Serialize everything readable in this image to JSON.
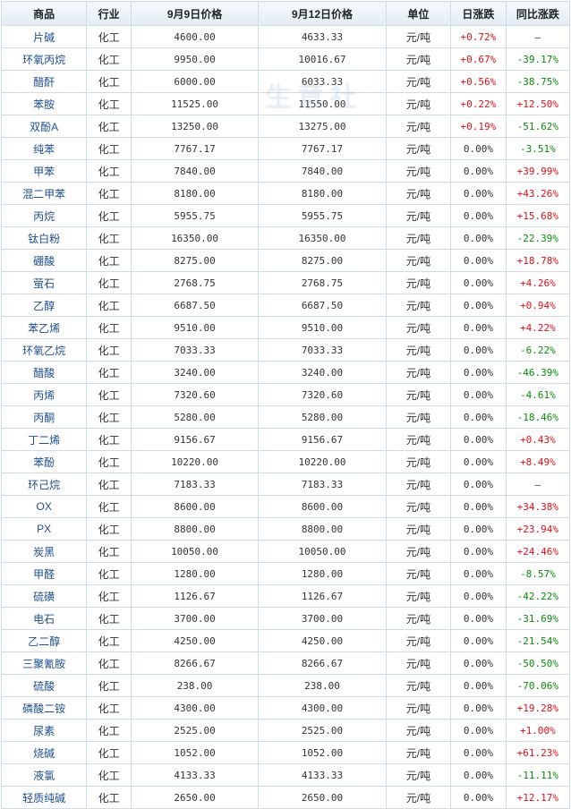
{
  "table": {
    "headers": [
      "商品",
      "行业",
      "9月9日价格",
      "9月12日价格",
      "单位",
      "日涨跌",
      "同比涨跌"
    ],
    "rows": [
      {
        "name": "片碱",
        "industry": "化工",
        "price1": "4600.00",
        "price2": "4633.33",
        "unit": "元/吨",
        "daily": "+0.72%",
        "yoy": "—"
      },
      {
        "name": "环氧丙烷",
        "industry": "化工",
        "price1": "9950.00",
        "price2": "10016.67",
        "unit": "元/吨",
        "daily": "+0.67%",
        "yoy": "-39.17%"
      },
      {
        "name": "醋酐",
        "industry": "化工",
        "price1": "6000.00",
        "price2": "6033.33",
        "unit": "元/吨",
        "daily": "+0.56%",
        "yoy": "-38.75%"
      },
      {
        "name": "苯胺",
        "industry": "化工",
        "price1": "11525.00",
        "price2": "11550.00",
        "unit": "元/吨",
        "daily": "+0.22%",
        "yoy": "+12.50%"
      },
      {
        "name": "双酚A",
        "industry": "化工",
        "price1": "13250.00",
        "price2": "13275.00",
        "unit": "元/吨",
        "daily": "+0.19%",
        "yoy": "-51.62%"
      },
      {
        "name": "纯苯",
        "industry": "化工",
        "price1": "7767.17",
        "price2": "7767.17",
        "unit": "元/吨",
        "daily": "0.00%",
        "yoy": "-3.51%"
      },
      {
        "name": "甲苯",
        "industry": "化工",
        "price1": "7840.00",
        "price2": "7840.00",
        "unit": "元/吨",
        "daily": "0.00%",
        "yoy": "+39.99%"
      },
      {
        "name": "混二甲苯",
        "industry": "化工",
        "price1": "8180.00",
        "price2": "8180.00",
        "unit": "元/吨",
        "daily": "0.00%",
        "yoy": "+43.26%"
      },
      {
        "name": "丙烷",
        "industry": "化工",
        "price1": "5955.75",
        "price2": "5955.75",
        "unit": "元/吨",
        "daily": "0.00%",
        "yoy": "+15.68%"
      },
      {
        "name": "钛白粉",
        "industry": "化工",
        "price1": "16350.00",
        "price2": "16350.00",
        "unit": "元/吨",
        "daily": "0.00%",
        "yoy": "-22.39%"
      },
      {
        "name": "硼酸",
        "industry": "化工",
        "price1": "8275.00",
        "price2": "8275.00",
        "unit": "元/吨",
        "daily": "0.00%",
        "yoy": "+18.78%"
      },
      {
        "name": "萤石",
        "industry": "化工",
        "price1": "2768.75",
        "price2": "2768.75",
        "unit": "元/吨",
        "daily": "0.00%",
        "yoy": "+4.26%"
      },
      {
        "name": "乙醇",
        "industry": "化工",
        "price1": "6687.50",
        "price2": "6687.50",
        "unit": "元/吨",
        "daily": "0.00%",
        "yoy": "+0.94%"
      },
      {
        "name": "苯乙烯",
        "industry": "化工",
        "price1": "9510.00",
        "price2": "9510.00",
        "unit": "元/吨",
        "daily": "0.00%",
        "yoy": "+4.22%"
      },
      {
        "name": "环氧乙烷",
        "industry": "化工",
        "price1": "7033.33",
        "price2": "7033.33",
        "unit": "元/吨",
        "daily": "0.00%",
        "yoy": "-6.22%"
      },
      {
        "name": "醋酸",
        "industry": "化工",
        "price1": "3240.00",
        "price2": "3240.00",
        "unit": "元/吨",
        "daily": "0.00%",
        "yoy": "-46.39%"
      },
      {
        "name": "丙烯",
        "industry": "化工",
        "price1": "7320.60",
        "price2": "7320.60",
        "unit": "元/吨",
        "daily": "0.00%",
        "yoy": "-4.61%"
      },
      {
        "name": "丙酮",
        "industry": "化工",
        "price1": "5280.00",
        "price2": "5280.00",
        "unit": "元/吨",
        "daily": "0.00%",
        "yoy": "-18.46%"
      },
      {
        "name": "丁二烯",
        "industry": "化工",
        "price1": "9156.67",
        "price2": "9156.67",
        "unit": "元/吨",
        "daily": "0.00%",
        "yoy": "+0.43%"
      },
      {
        "name": "苯酚",
        "industry": "化工",
        "price1": "10220.00",
        "price2": "10220.00",
        "unit": "元/吨",
        "daily": "0.00%",
        "yoy": "+8.49%"
      },
      {
        "name": "环己烷",
        "industry": "化工",
        "price1": "7183.33",
        "price2": "7183.33",
        "unit": "元/吨",
        "daily": "0.00%",
        "yoy": "—"
      },
      {
        "name": "OX",
        "industry": "化工",
        "price1": "8600.00",
        "price2": "8600.00",
        "unit": "元/吨",
        "daily": "0.00%",
        "yoy": "+34.38%"
      },
      {
        "name": "PX",
        "industry": "化工",
        "price1": "8800.00",
        "price2": "8800.00",
        "unit": "元/吨",
        "daily": "0.00%",
        "yoy": "+23.94%"
      },
      {
        "name": "炭黑",
        "industry": "化工",
        "price1": "10050.00",
        "price2": "10050.00",
        "unit": "元/吨",
        "daily": "0.00%",
        "yoy": "+24.46%"
      },
      {
        "name": "甲醛",
        "industry": "化工",
        "price1": "1280.00",
        "price2": "1280.00",
        "unit": "元/吨",
        "daily": "0.00%",
        "yoy": "-8.57%"
      },
      {
        "name": "硫磺",
        "industry": "化工",
        "price1": "1126.67",
        "price2": "1126.67",
        "unit": "元/吨",
        "daily": "0.00%",
        "yoy": "-42.22%"
      },
      {
        "name": "电石",
        "industry": "化工",
        "price1": "3700.00",
        "price2": "3700.00",
        "unit": "元/吨",
        "daily": "0.00%",
        "yoy": "-31.69%"
      },
      {
        "name": "乙二醇",
        "industry": "化工",
        "price1": "4250.00",
        "price2": "4250.00",
        "unit": "元/吨",
        "daily": "0.00%",
        "yoy": "-21.54%"
      },
      {
        "name": "三聚氰胺",
        "industry": "化工",
        "price1": "8266.67",
        "price2": "8266.67",
        "unit": "元/吨",
        "daily": "0.00%",
        "yoy": "-50.50%"
      },
      {
        "name": "硫酸",
        "industry": "化工",
        "price1": "238.00",
        "price2": "238.00",
        "unit": "元/吨",
        "daily": "0.00%",
        "yoy": "-70.06%"
      },
      {
        "name": "磷酸二铵",
        "industry": "化工",
        "price1": "4300.00",
        "price2": "4300.00",
        "unit": "元/吨",
        "daily": "0.00%",
        "yoy": "+19.28%"
      },
      {
        "name": "尿素",
        "industry": "化工",
        "price1": "2525.00",
        "price2": "2525.00",
        "unit": "元/吨",
        "daily": "0.00%",
        "yoy": "+1.00%"
      },
      {
        "name": "烧碱",
        "industry": "化工",
        "price1": "1052.00",
        "price2": "1052.00",
        "unit": "元/吨",
        "daily": "0.00%",
        "yoy": "+61.23%"
      },
      {
        "name": "液氯",
        "industry": "化工",
        "price1": "4133.33",
        "price2": "4133.33",
        "unit": "元/吨",
        "daily": "0.00%",
        "yoy": "-11.11%"
      },
      {
        "name": "轻质纯碱",
        "industry": "化工",
        "price1": "2650.00",
        "price2": "2650.00",
        "unit": "元/吨",
        "daily": "0.00%",
        "yoy": "+12.17%"
      }
    ]
  },
  "watermark": {
    "text": "生意社"
  },
  "colors": {
    "up": "#e0101a",
    "down": "#0a8a0a",
    "link": "#1f4e8c",
    "border": "#cfdbe6"
  }
}
